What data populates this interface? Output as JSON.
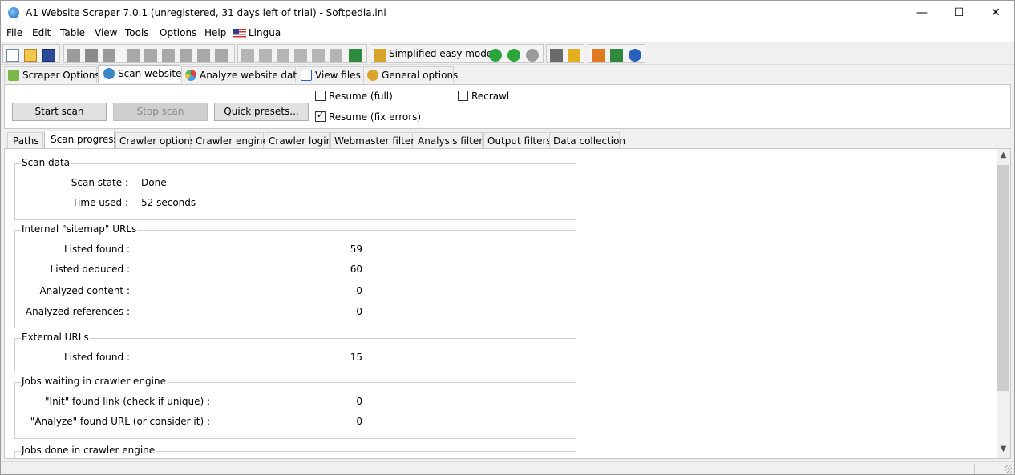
{
  "window": {
    "title": "A1 Website Scraper 7.0.1 (unregistered, 31 days left of trial) - Softpedia.ini",
    "minimize": "—",
    "maximize": "☐",
    "close": "✕"
  },
  "menu": [
    "File",
    "Edit",
    "Table",
    "View",
    "Tools",
    "Options",
    "Help",
    "Lingua"
  ],
  "toolbar": {
    "simplified_label": "Simplified easy mode"
  },
  "main_tabs": [
    {
      "label": "Scraper Options",
      "icon": "puzzle-icon"
    },
    {
      "label": "Scan website",
      "icon": "magnifier-icon"
    },
    {
      "label": "Analyze website data",
      "icon": "pie-chart-icon"
    },
    {
      "label": "View files",
      "icon": "list-icon"
    },
    {
      "label": "General options",
      "icon": "gears-icon"
    }
  ],
  "scan_panel": {
    "start": "Start scan",
    "stop": "Stop scan",
    "presets": "Quick presets...",
    "resume_full": "Resume (full)",
    "resume_fix": "Resume (fix errors)",
    "recrawl": "Recrawl"
  },
  "sub_tabs": [
    "Paths",
    "Scan progress",
    "Crawler options",
    "Crawler engine",
    "Crawler login",
    "Webmaster filters",
    "Analysis filters",
    "Output filters",
    "Data collection"
  ],
  "scan_data": {
    "title": "Scan data",
    "state_label": "Scan state :",
    "state_value": "Done",
    "time_label": "Time used :",
    "time_value": "52 seconds"
  },
  "internal": {
    "title": "Internal \"sitemap\" URLs",
    "rows": [
      {
        "label": "Listed found :",
        "value": "59"
      },
      {
        "label": "Listed deduced :",
        "value": "60"
      },
      {
        "label": "Analyzed content :",
        "value": "0"
      },
      {
        "label": "Analyzed references :",
        "value": "0"
      }
    ]
  },
  "external": {
    "title": "External URLs",
    "rows": [
      {
        "label": "Listed found :",
        "value": "15"
      }
    ]
  },
  "jobs_waiting": {
    "title": "Jobs waiting in crawler engine",
    "rows": [
      {
        "label": "\"Init\" found link (check if unique) :",
        "value": "0"
      },
      {
        "label": "\"Analyze\" found URL (or consider it) :",
        "value": "0"
      }
    ]
  },
  "jobs_done": {
    "title": "Jobs done in crawler engine"
  }
}
